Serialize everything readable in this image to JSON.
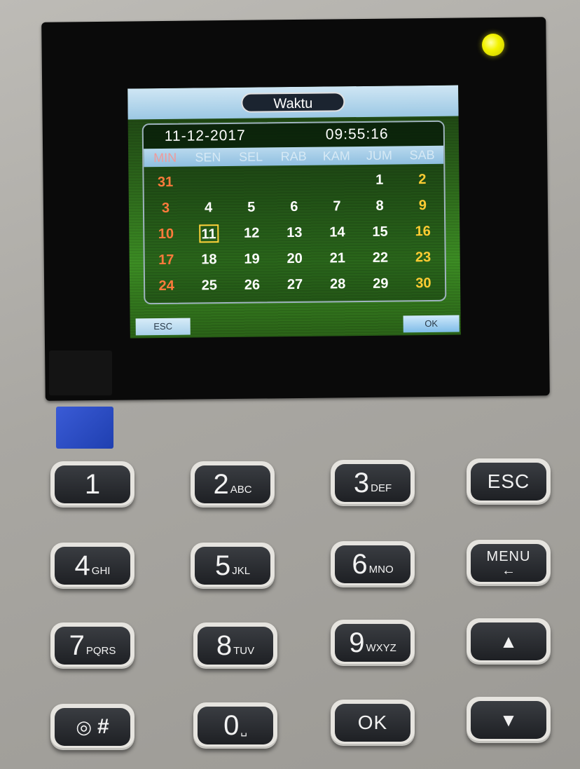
{
  "screen": {
    "title": "Waktu",
    "date": "11-12-2017",
    "time": "09:55:16",
    "weekdays": [
      "MIN",
      "SEN",
      "SEL",
      "RAB",
      "KAM",
      "JUM",
      "SAB"
    ],
    "weeks": [
      [
        "31",
        "",
        "",
        "",
        "",
        "1",
        "2"
      ],
      [
        "3",
        "4",
        "5",
        "6",
        "7",
        "8",
        "9"
      ],
      [
        "10",
        "11",
        "12",
        "13",
        "14",
        "15",
        "16"
      ],
      [
        "17",
        "18",
        "19",
        "20",
        "21",
        "22",
        "23"
      ],
      [
        "24",
        "25",
        "26",
        "27",
        "28",
        "29",
        "30"
      ]
    ],
    "selected_day": "11",
    "esc_label": "ESC",
    "ok_label": "OK"
  },
  "keypad": {
    "keys": [
      {
        "main": "1",
        "sub": ""
      },
      {
        "main": "2",
        "sub": "ABC"
      },
      {
        "main": "3",
        "sub": "DEF"
      },
      {
        "main": "ESC",
        "sub": ""
      },
      {
        "main": "4",
        "sub": "GHI"
      },
      {
        "main": "5",
        "sub": "JKL"
      },
      {
        "main": "6",
        "sub": "MNO"
      },
      {
        "main": "MENU",
        "sub": "←"
      },
      {
        "main": "7",
        "sub": "PQRS"
      },
      {
        "main": "8",
        "sub": "TUV"
      },
      {
        "main": "9",
        "sub": "WXYZ"
      },
      {
        "main": "▲",
        "sub": ""
      },
      {
        "main": "◎",
        "sub": "#"
      },
      {
        "main": "0",
        "sub": "␣"
      },
      {
        "main": "OK",
        "sub": ""
      },
      {
        "main": "▼",
        "sub": ""
      }
    ]
  },
  "colors": {
    "led": "#f3f300",
    "sunday": "#ff7a3c",
    "saturday": "#ffcc33",
    "selected_box": "#ffd23a",
    "indicator": "#2a4cc8"
  }
}
